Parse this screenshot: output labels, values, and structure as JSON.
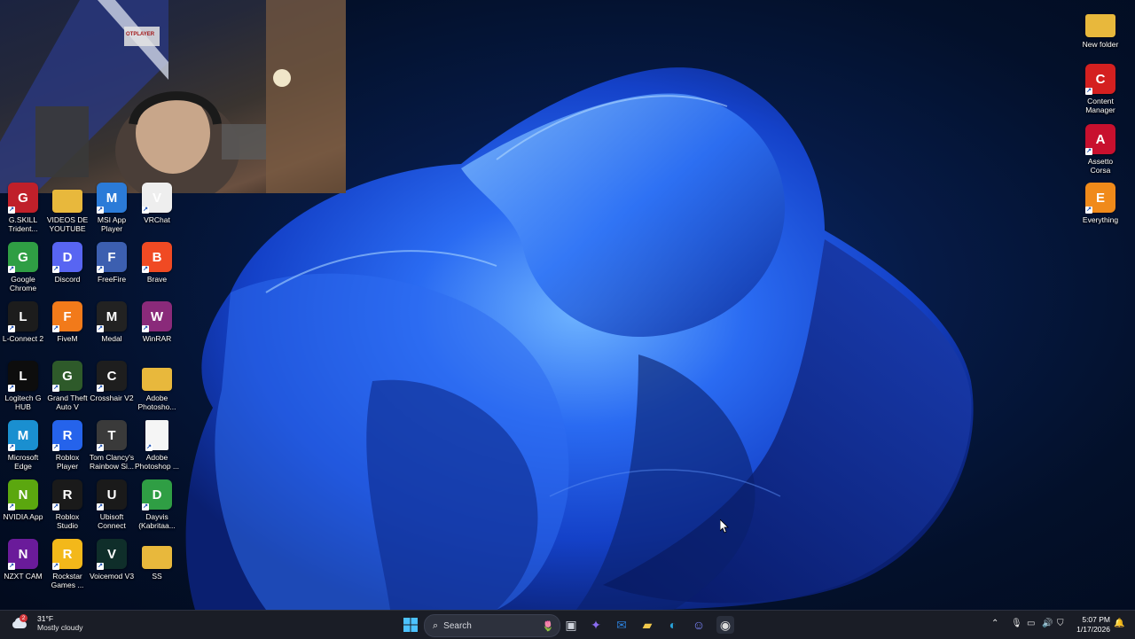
{
  "desktop": {
    "left_icons": [
      {
        "label": "G.SKILL Trident...",
        "icon": "gskill-icon",
        "color": "#c0202a"
      },
      {
        "label": "VIDEOS DE YOUTUBE",
        "icon": "folder-icon",
        "color": "#e8b83c"
      },
      {
        "label": "MSI App Player",
        "icon": "msi-app-player-icon",
        "color": "#2b7bd8"
      },
      {
        "label": "VRChat",
        "icon": "vrchat-icon",
        "color": "#eeeeee"
      },
      {
        "label": "Google Chrome",
        "icon": "chrome-icon",
        "color": "#2f9e44"
      },
      {
        "label": "Discord",
        "icon": "discord-icon",
        "color": "#5865f2"
      },
      {
        "label": "FreeFire",
        "icon": "freefire-icon",
        "color": "#3c5fb0"
      },
      {
        "label": "Brave",
        "icon": "brave-icon",
        "color": "#f04a23"
      },
      {
        "label": "L-Connect 2",
        "icon": "lconnect-icon",
        "color": "#1c1c1c"
      },
      {
        "label": "FiveM",
        "icon": "fivem-icon",
        "color": "#f27a1a"
      },
      {
        "label": "Medal",
        "icon": "medal-icon",
        "color": "#222222"
      },
      {
        "label": "WinRAR",
        "icon": "winrar-icon",
        "color": "#8a2a7a"
      },
      {
        "label": "Logitech G HUB",
        "icon": "logitech-ghub-icon",
        "color": "#0d0d0d"
      },
      {
        "label": "Grand Theft Auto V",
        "icon": "gta-v-icon",
        "color": "#2e5a2a"
      },
      {
        "label": "Crosshair V2",
        "icon": "crosshair-icon",
        "color": "#1e1e1e"
      },
      {
        "label": "Adobe Photosho...",
        "icon": "folder-icon",
        "color": "#e8b83c"
      },
      {
        "label": "Microsoft Edge",
        "icon": "edge-icon",
        "color": "#1a8fd0"
      },
      {
        "label": "Roblox Player",
        "icon": "roblox-player-icon",
        "color": "#2563eb"
      },
      {
        "label": "Tom Clancy's Rainbow Si...",
        "icon": "rainbow-six-icon",
        "color": "#3a3a3a"
      },
      {
        "label": "Adobe Photoshop ...",
        "icon": "document-icon",
        "color": "#f5f5f5"
      },
      {
        "label": "NVIDIA App",
        "icon": "nvidia-icon",
        "color": "#5ba70f"
      },
      {
        "label": "Roblox Studio",
        "icon": "roblox-studio-icon",
        "color": "#1a1a1a"
      },
      {
        "label": "Ubisoft Connect",
        "icon": "ubisoft-icon",
        "color": "#1a1a1a"
      },
      {
        "label": "Dayvis (Kabritaa...",
        "icon": "chrome-profile-icon",
        "color": "#2f9e44"
      },
      {
        "label": "NZXT CAM",
        "icon": "nzxt-cam-icon",
        "color": "#6a1b9a"
      },
      {
        "label": "Rockstar Games ...",
        "icon": "rockstar-icon",
        "color": "#f3b81a"
      },
      {
        "label": "Voicemod V3",
        "icon": "voicemod-icon",
        "color": "#0f2e2a"
      },
      {
        "label": "SS",
        "icon": "folder-icon",
        "color": "#e8b83c"
      }
    ],
    "right_icons": [
      {
        "label": "New folder",
        "icon": "folder-icon",
        "color": "#e8b83c"
      },
      {
        "label": "Content Manager",
        "icon": "content-manager-icon",
        "color": "#d42020"
      },
      {
        "label": "Assetto Corsa",
        "icon": "assetto-corsa-icon",
        "color": "#c8102e"
      },
      {
        "label": "Everything",
        "icon": "everything-search-icon",
        "color": "#f08a1a"
      }
    ]
  },
  "webcam_overlay": {
    "sticker_text": "OTPLAYER"
  },
  "taskbar": {
    "weather": {
      "badge": "2",
      "temp": "31°F",
      "condition": "Mostly cloudy"
    },
    "search_placeholder": "Search",
    "pinned": [
      {
        "icon": "start-icon"
      },
      {
        "icon": "task-view-icon"
      },
      {
        "icon": "copilot-icon"
      },
      {
        "icon": "outlook-icon"
      },
      {
        "icon": "file-explorer-icon"
      },
      {
        "icon": "edge-icon"
      },
      {
        "icon": "discord-icon"
      },
      {
        "icon": "obs-icon"
      }
    ],
    "clock": {
      "time": "5:07 PM",
      "date": "1/17/2026"
    }
  },
  "colors": {
    "taskbar": "#1a1d26",
    "accent": "#1f6feb"
  }
}
